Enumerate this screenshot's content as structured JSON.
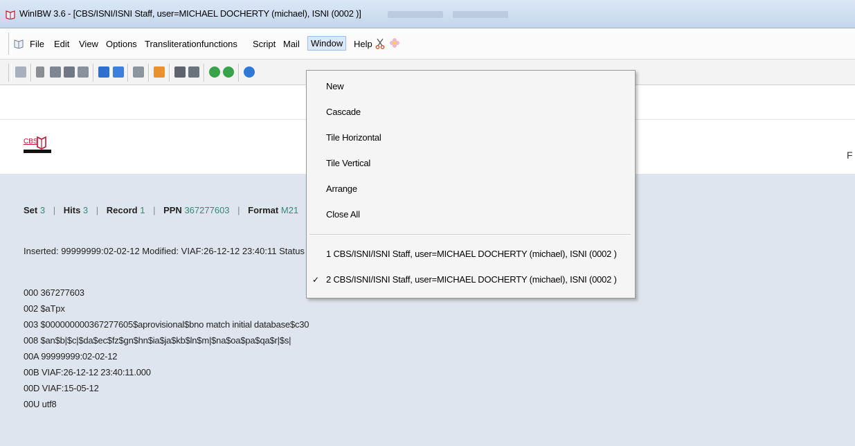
{
  "window": {
    "title": "WinIBW 3.6 - [CBS/ISNI/ISNI Staff, user=MICHAEL DOCHERTY (michael), ISNI (0002 )]"
  },
  "menubar": {
    "items": [
      {
        "label": "File"
      },
      {
        "label": "Edit"
      },
      {
        "label": "View"
      },
      {
        "label": "Options"
      },
      {
        "label": "Transliterationfunctions"
      },
      {
        "label": "Script"
      },
      {
        "label": "Mail"
      },
      {
        "label": "Window"
      },
      {
        "label": "Help"
      }
    ],
    "active": "Window"
  },
  "banner": {
    "logo_text": "CBS",
    "edge_text": "F"
  },
  "record": {
    "set_label": "Set",
    "set_value": "3",
    "hits_label": "Hits",
    "hits_value": "3",
    "record_label": "Record",
    "record_value": "1",
    "ppn_label": "PPN",
    "ppn_value": "367277603",
    "format_label": "Format",
    "format_value": "M21",
    "inserted": "Inserted: 99999999:02-02-12 Modified: VIAF:26-12-12 23:40:11 Status",
    "lines": [
      "000 367277603",
      "002 $aTpx",
      "003 $000000000367277605$aprovisional$bno match initial database$c30",
      "008 $an$b|$c|$da$ec$fz$gn$hn$ia$ja$kb$ln$m|$na$oa$pa$qa$r|$s|",
      "00A 99999999:02-02-12",
      "00B VIAF:26-12-12 23:40:11.000",
      "00D VIAF:15-05-12",
      "00U utf8"
    ]
  },
  "window_menu": {
    "items": [
      "New",
      "Cascade",
      "Tile Horizontal",
      "Tile Vertical",
      "Arrange",
      "Close All"
    ],
    "windows": [
      {
        "label": "1 CBS/ISNI/ISNI Staff, user=MICHAEL DOCHERTY (michael), ISNI (0002 )",
        "checked": false
      },
      {
        "label": "2 CBS/ISNI/ISNI Staff, user=MICHAEL DOCHERTY (michael), ISNI (0002 )",
        "checked": true
      }
    ]
  },
  "colors": {
    "accent_number": "#2e8a7c",
    "content_bg": "#dfe5ee",
    "logo_red": "#c8102e"
  }
}
